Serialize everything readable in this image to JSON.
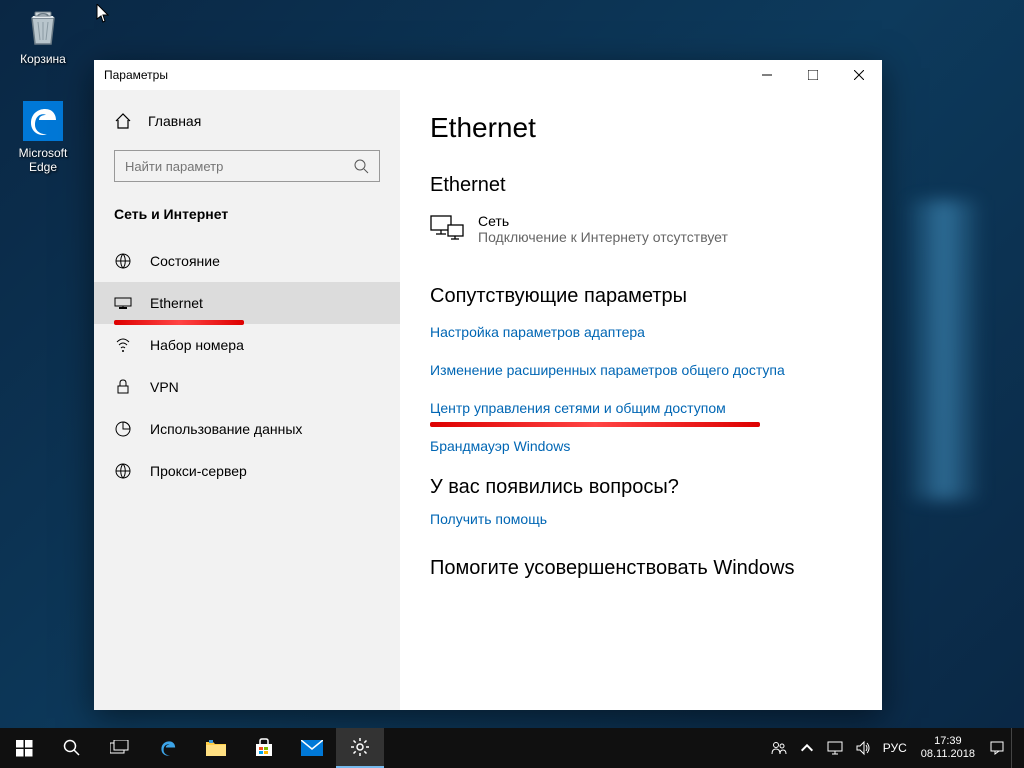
{
  "desktop": {
    "recycle_bin": "Корзина",
    "edge": "Microsoft Edge"
  },
  "window": {
    "title": "Параметры",
    "sidebar": {
      "home": "Главная",
      "search_placeholder": "Найти параметр",
      "category": "Сеть и Интернет",
      "items": [
        {
          "id": "status",
          "label": "Состояние"
        },
        {
          "id": "ethernet",
          "label": "Ethernet"
        },
        {
          "id": "dialup",
          "label": "Набор номера"
        },
        {
          "id": "vpn",
          "label": "VPN"
        },
        {
          "id": "data",
          "label": "Использование данных"
        },
        {
          "id": "proxy",
          "label": "Прокси-сервер"
        }
      ]
    },
    "main": {
      "title": "Ethernet",
      "section_ethernet": "Ethernet",
      "net_name": "Сеть",
      "net_status": "Подключение к Интернету отсутствует",
      "related_title": "Сопутствующие параметры",
      "links": [
        {
          "label": "Настройка параметров адаптера"
        },
        {
          "label": "Изменение расширенных параметров общего доступа"
        },
        {
          "label": "Центр управления сетями и общим доступом",
          "marked": true
        },
        {
          "label": "Брандмауэр Windows"
        }
      ],
      "questions_title": "У вас появились вопросы?",
      "help_link": "Получить помощь",
      "improve_title": "Помогите усовершенствовать Windows"
    }
  },
  "taskbar": {
    "lang": "РУС",
    "time": "17:39",
    "date": "08.11.2018"
  }
}
